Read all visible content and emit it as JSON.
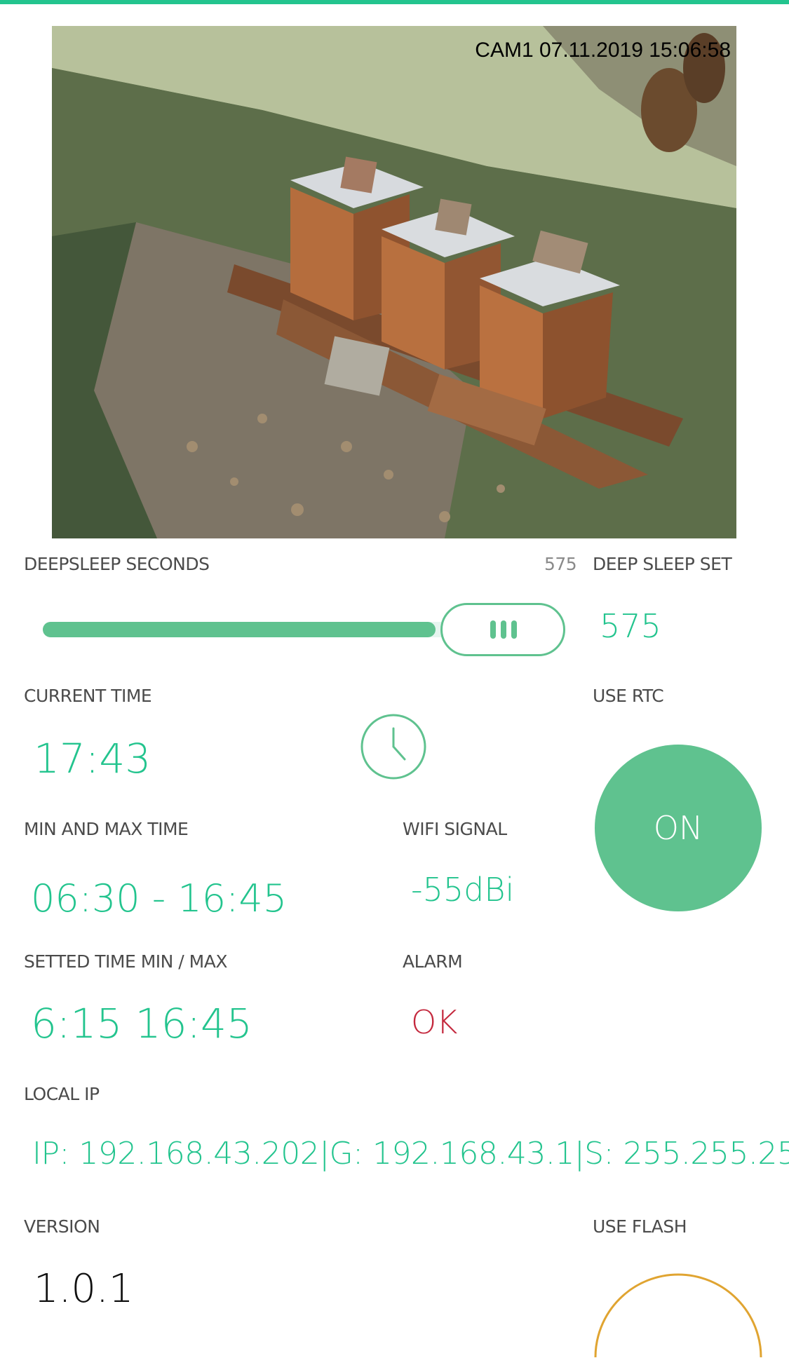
{
  "camera": {
    "stamp": "CAM1 07.11.2019 15:06:58"
  },
  "deepsleep": {
    "label": "DEEPSLEEP SECONDS",
    "slider_value": 575,
    "slider_value_text": "575",
    "slider_fraction": 0.8,
    "set_label": "DEEP SLEEP SET",
    "set_value": "575"
  },
  "current_time": {
    "label": "CURRENT TIME",
    "value": "17:43",
    "icon": "clock-icon"
  },
  "rtc": {
    "label": "USE RTC",
    "button": "ON"
  },
  "min_max_time": {
    "label": "MIN AND MAX TIME",
    "value": "06:30 - 16:45"
  },
  "wifi": {
    "label": "WIFI SIGNAL",
    "value": "-55dBi"
  },
  "setted_time": {
    "label": "SETTED TIME MIN / MAX",
    "value": "6:15 16:45"
  },
  "alarm": {
    "label": "ALARM",
    "value": "OK"
  },
  "local_ip": {
    "label": "LOCAL IP",
    "value": "IP: 192.168.43.202|G: 192.168.43.1|S: 255.255.25..."
  },
  "version": {
    "label": "VERSION",
    "value": "1.0.1"
  },
  "flash": {
    "label": "USE FLASH"
  },
  "colors": {
    "accent": "#23c48e",
    "alarm_ok": "#c4283d",
    "flash": "#e0a431"
  }
}
